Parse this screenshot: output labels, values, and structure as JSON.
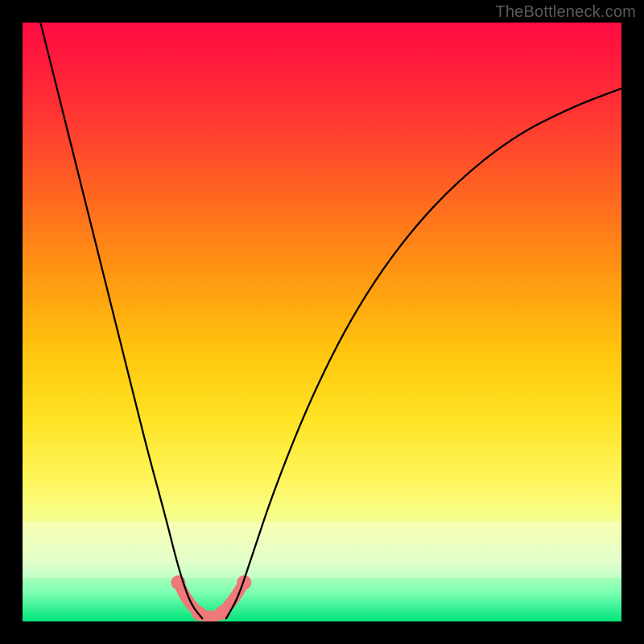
{
  "watermark": "TheBottleneck.com",
  "chart_data": {
    "type": "line",
    "title": "",
    "xlabel": "",
    "ylabel": "",
    "x_range": [
      0,
      100
    ],
    "y_range": [
      0,
      100
    ],
    "grid": false,
    "legend": false,
    "background_gradient": {
      "orientation": "vertical",
      "stops": [
        {
          "pos": 0.0,
          "color": "#ff0b42"
        },
        {
          "pos": 0.18,
          "color": "#ff3e2f"
        },
        {
          "pos": 0.42,
          "color": "#ff9712"
        },
        {
          "pos": 0.66,
          "color": "#ffe324"
        },
        {
          "pos": 0.83,
          "color": "#f6ff8e"
        },
        {
          "pos": 0.95,
          "color": "#7fffb4"
        },
        {
          "pos": 1.0,
          "color": "#00e57b"
        }
      ]
    },
    "series": [
      {
        "name": "curve-left",
        "stroke": "#000000",
        "points": [
          {
            "x": 3.0,
            "y": 100.0
          },
          {
            "x": 6.0,
            "y": 88.0
          },
          {
            "x": 9.0,
            "y": 76.0
          },
          {
            "x": 12.0,
            "y": 64.0
          },
          {
            "x": 15.0,
            "y": 52.0
          },
          {
            "x": 18.0,
            "y": 40.0
          },
          {
            "x": 21.0,
            "y": 28.0
          },
          {
            "x": 24.0,
            "y": 17.0
          },
          {
            "x": 26.0,
            "y": 9.0
          },
          {
            "x": 28.0,
            "y": 3.0
          },
          {
            "x": 30.0,
            "y": 0.5
          }
        ]
      },
      {
        "name": "curve-right",
        "stroke": "#000000",
        "points": [
          {
            "x": 34.0,
            "y": 0.5
          },
          {
            "x": 36.0,
            "y": 4.0
          },
          {
            "x": 38.0,
            "y": 10.0
          },
          {
            "x": 42.0,
            "y": 22.0
          },
          {
            "x": 48.0,
            "y": 37.0
          },
          {
            "x": 55.0,
            "y": 51.0
          },
          {
            "x": 63.0,
            "y": 63.0
          },
          {
            "x": 72.0,
            "y": 73.0
          },
          {
            "x": 82.0,
            "y": 81.0
          },
          {
            "x": 92.0,
            "y": 86.0
          },
          {
            "x": 100.0,
            "y": 89.0
          }
        ]
      },
      {
        "name": "highlight-segment",
        "stroke": "#f07878",
        "stroke_width": 14,
        "points": [
          {
            "x": 26.0,
            "y": 6.5
          },
          {
            "x": 27.5,
            "y": 3.5
          },
          {
            "x": 29.5,
            "y": 1.3
          },
          {
            "x": 31.5,
            "y": 0.6
          },
          {
            "x": 33.5,
            "y": 1.5
          },
          {
            "x": 35.5,
            "y": 4.0
          },
          {
            "x": 37.0,
            "y": 6.5
          }
        ]
      }
    ],
    "markers": [
      {
        "x": 26.0,
        "y": 6.5,
        "color": "#f07878",
        "r": 9
      },
      {
        "x": 29.5,
        "y": 1.3,
        "color": "#f07878",
        "r": 9
      },
      {
        "x": 31.5,
        "y": 0.6,
        "color": "#f07878",
        "r": 9
      },
      {
        "x": 33.5,
        "y": 1.5,
        "color": "#f07878",
        "r": 9
      },
      {
        "x": 37.0,
        "y": 6.5,
        "color": "#f07878",
        "r": 9
      }
    ],
    "highlight_band_y": [
      7,
      16
    ]
  }
}
